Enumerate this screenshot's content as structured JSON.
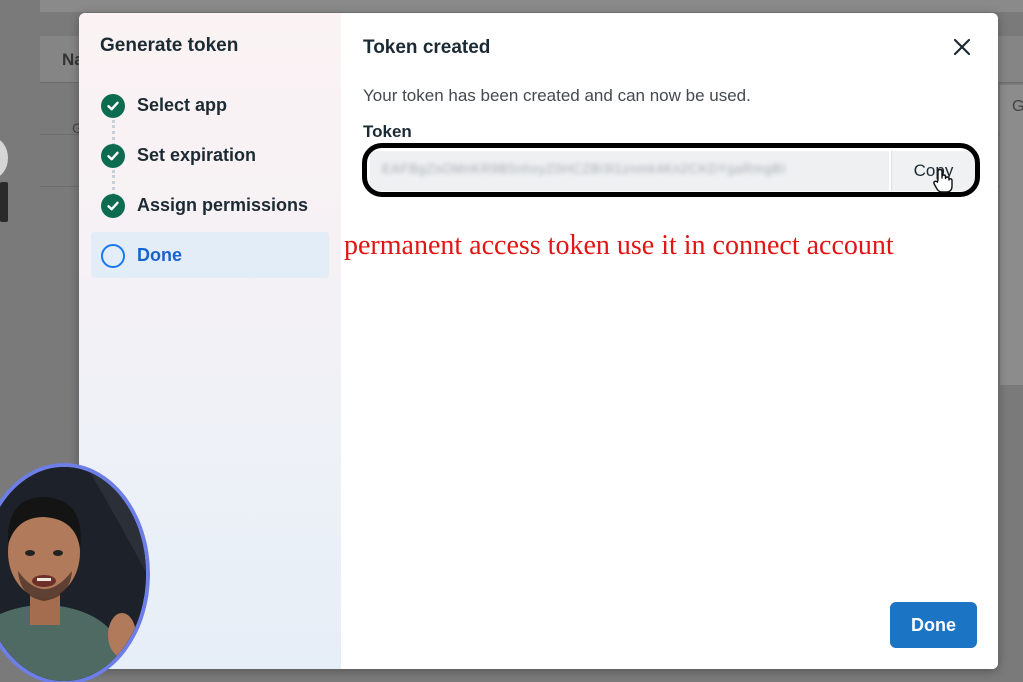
{
  "background": {
    "column_label_partial": "Na",
    "left_cell_partial": "G",
    "right_cell_partial": "G"
  },
  "sidebar": {
    "title": "Generate token",
    "steps": [
      {
        "label": "Select app",
        "status": "complete",
        "icon": "check-circle-icon"
      },
      {
        "label": "Set expiration",
        "status": "complete",
        "icon": "check-circle-icon"
      },
      {
        "label": "Assign permissions",
        "status": "complete",
        "icon": "check-circle-icon"
      },
      {
        "label": "Done",
        "status": "current",
        "icon": "empty-circle-icon"
      }
    ]
  },
  "main": {
    "title": "Token created",
    "description": "Your token has been created and can now be used.",
    "token_label": "Token",
    "token_value": "EAFBgZsOMnKR9B5nhxyZ0HCZBi3l1znmk4Kn2CKDYgaRmgBI",
    "copy_label": "Copy",
    "done_label": "Done"
  },
  "annotation": "permanent access token use it in connect account",
  "colors": {
    "check_green": "#0d6b4f",
    "primary_blue": "#1b74c4",
    "active_step_text": "#1763cf",
    "annotation_red": "#e31414",
    "webcam_ring": "#6d7ee6"
  }
}
